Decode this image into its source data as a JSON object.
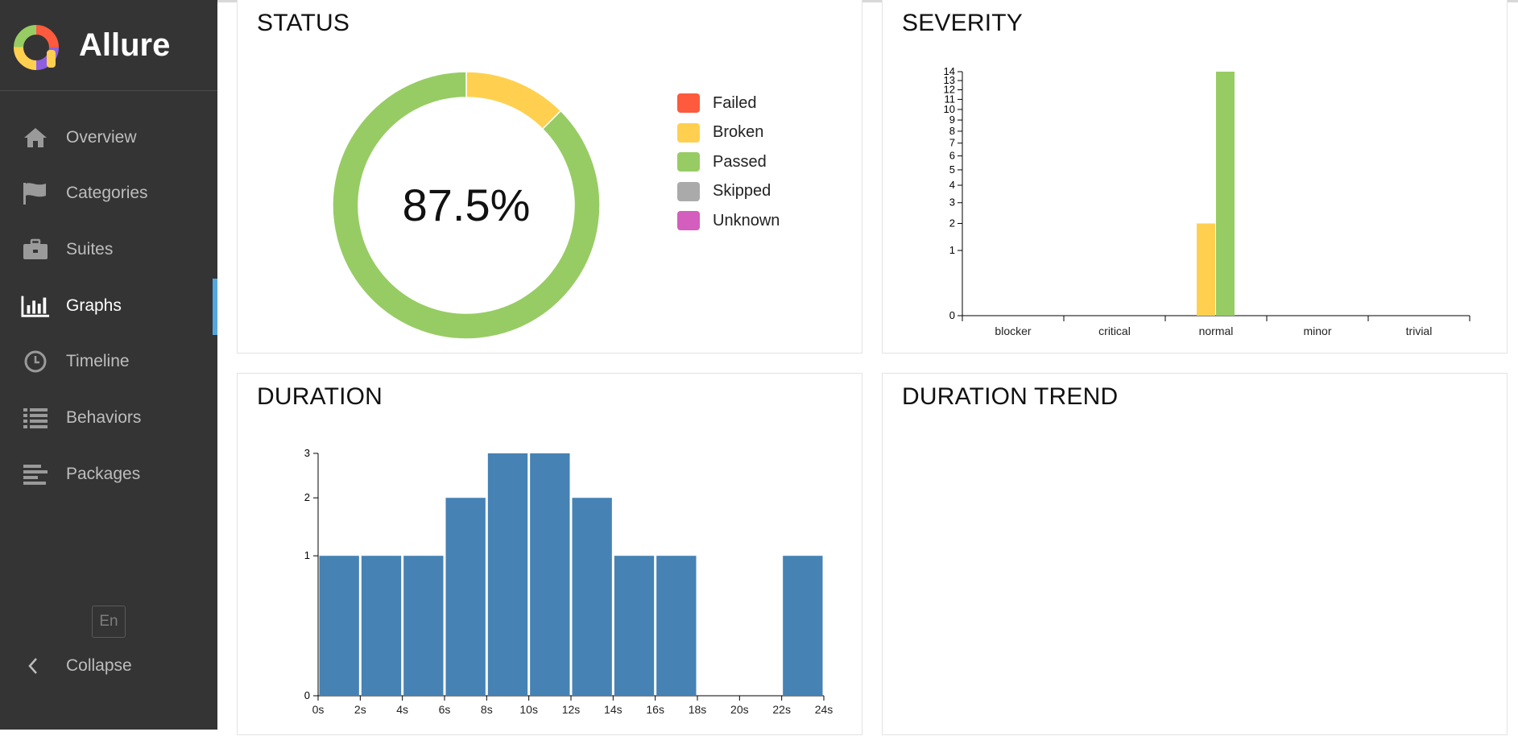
{
  "brand": {
    "name": "Allure"
  },
  "sidebar": {
    "items": [
      {
        "label": "Overview",
        "icon": "home-icon",
        "active": false
      },
      {
        "label": "Categories",
        "icon": "flag-icon",
        "active": false
      },
      {
        "label": "Suites",
        "icon": "briefcase-icon",
        "active": false
      },
      {
        "label": "Graphs",
        "icon": "bar-chart-icon",
        "active": true
      },
      {
        "label": "Timeline",
        "icon": "clock-icon",
        "active": false
      },
      {
        "label": "Behaviors",
        "icon": "list-icon",
        "active": false
      },
      {
        "label": "Packages",
        "icon": "align-left-icon",
        "active": false
      }
    ],
    "language": "En",
    "collapse_label": "Collapse"
  },
  "widgets": {
    "status": {
      "title": "STATUS"
    },
    "severity": {
      "title": "SEVERITY"
    },
    "duration": {
      "title": "DURATION"
    },
    "duration_trend": {
      "title": "DURATION TREND"
    }
  },
  "colors": {
    "failed": "#fd5a3e",
    "broken": "#ffd050",
    "passed": "#97cc64",
    "skipped": "#aaaaaa",
    "unknown": "#d35ebe",
    "duration_bar": "#4682b4",
    "sidebar_bg": "#343434",
    "active_indicator": "#53a7e0"
  },
  "chart_data": [
    {
      "type": "pie",
      "title": "STATUS",
      "center_label": "87.5%",
      "slices": [
        {
          "name": "Failed",
          "value": 0,
          "color": "#fd5a3e"
        },
        {
          "name": "Broken",
          "value": 2,
          "color": "#ffd050"
        },
        {
          "name": "Passed",
          "value": 14,
          "color": "#97cc64"
        },
        {
          "name": "Skipped",
          "value": 0,
          "color": "#aaaaaa"
        },
        {
          "name": "Unknown",
          "value": 0,
          "color": "#d35ebe"
        }
      ],
      "legend": "right"
    },
    {
      "type": "bar",
      "title": "SEVERITY",
      "categories": [
        "blocker",
        "critical",
        "normal",
        "minor",
        "trivial"
      ],
      "series": [
        {
          "name": "Broken",
          "values": [
            0,
            0,
            2,
            0,
            0
          ],
          "color": "#ffd050"
        },
        {
          "name": "Passed",
          "values": [
            0,
            0,
            14,
            0,
            0
          ],
          "color": "#97cc64"
        }
      ],
      "y_scale": "sqrt",
      "y_ticks": [
        "0",
        "1",
        "2",
        "3",
        "4",
        "5",
        "6",
        "7",
        "8",
        "9",
        "10",
        "11",
        "12",
        "13",
        "14"
      ],
      "ylim": [
        0,
        14
      ]
    },
    {
      "type": "bar",
      "title": "DURATION",
      "x_ticks": [
        "0s",
        "2s",
        "4s",
        "6s",
        "8s",
        "10s",
        "12s",
        "14s",
        "16s",
        "18s",
        "20s",
        "22s",
        "24s"
      ],
      "bins": [
        1,
        1,
        1,
        2,
        3,
        3,
        2,
        1,
        1,
        0,
        0,
        1
      ],
      "y_ticks": [
        "0",
        "1",
        "2",
        "3"
      ],
      "y_scale": "sqrt",
      "ylim": [
        0,
        3
      ]
    }
  ]
}
